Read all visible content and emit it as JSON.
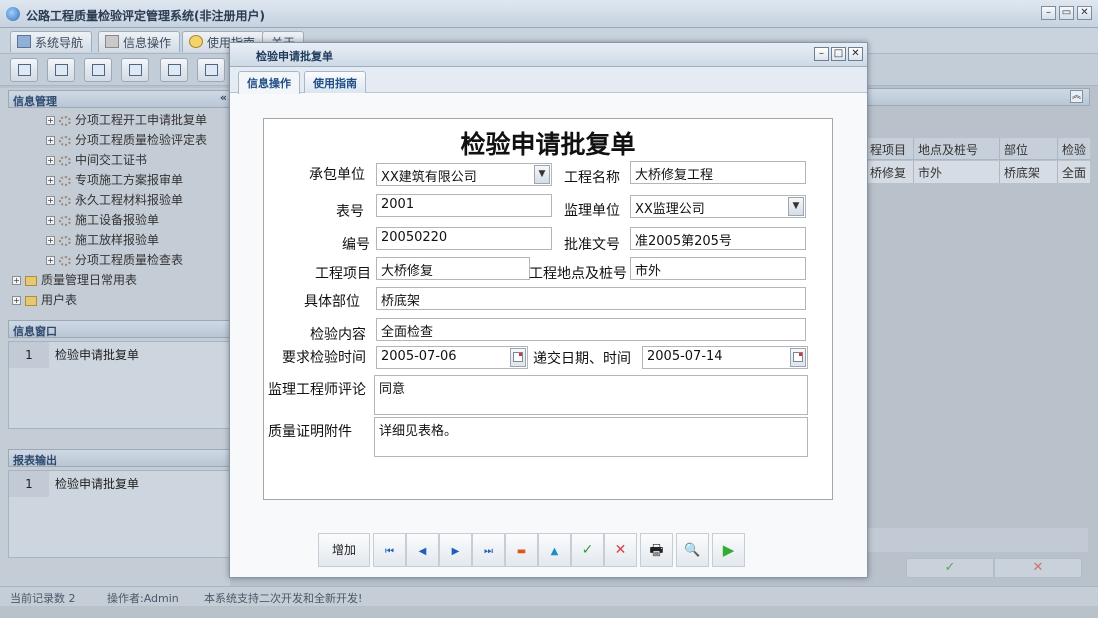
{
  "app": {
    "title": "公路工程质量检验评定管理系统(非注册用户)",
    "window_buttons": [
      "–",
      "▭",
      "✕"
    ]
  },
  "menu": {
    "tabs": [
      "系统导航",
      "信息操作",
      "使用指南",
      "关于"
    ]
  },
  "left": {
    "info_manage_title": "信息管理",
    "collapse_glyph": "«",
    "tree": [
      "分项工程开工申请批复单",
      "分项工程质量检验评定表",
      "中间交工证书",
      "专项施工方案报审单",
      "永久工程材料报验单",
      "施工设备报验单",
      "施工放样报验单",
      "分项工程质量检查表"
    ],
    "folders": [
      "质量管理日常用表",
      "用户表"
    ],
    "info_window_title": "信息窗口",
    "info_window_rows": [
      {
        "num": "1",
        "label": "检验申请批复单"
      }
    ],
    "report_title": "报表输出",
    "report_rows": [
      {
        "num": "1",
        "label": "检验申请批复单"
      }
    ]
  },
  "right": {
    "expand_glyph": "«",
    "grid_headers": [
      "程项目",
      "地点及桩号",
      "部位",
      "检验"
    ],
    "grid_row": [
      "桥修复",
      "市外",
      "桥底架",
      "全面"
    ],
    "check_glyph": "✓",
    "cross_glyph": "✕"
  },
  "status": {
    "records": "当前记录数 2",
    "operator": "操作者:Admin",
    "notice": "本系统支持二次开发和全新开发!"
  },
  "dialog": {
    "title": "检验申请批复单",
    "window_buttons": [
      "–",
      "□",
      "✕"
    ],
    "tabs": [
      "信息操作",
      "使用指南"
    ],
    "form_title": "检验申请批复单",
    "labels": {
      "contractor": "承包单位",
      "project_name": "工程名称",
      "form_no": "表号",
      "supervisor": "监理单位",
      "serial_no": "编号",
      "approval_no": "批准文号",
      "project_item": "工程项目",
      "location": "工程地点及桩号",
      "part": "具体部位",
      "content": "检验内容",
      "req_time": "要求检验时间",
      "submit_time": "递交日期、时间",
      "engineer_comment": "监理工程师评论",
      "attachment": "质量证明附件"
    },
    "values": {
      "contractor": "XX建筑有限公司",
      "project_name": "大桥修复工程",
      "form_no": "2001",
      "supervisor": "XX监理公司",
      "serial_no": "20050220",
      "approval_no": "准2005第205号",
      "project_item": "大桥修复",
      "location": "市外",
      "part": "桥底架",
      "content": "全面检查",
      "req_time": "2005-07-06",
      "submit_time": "2005-07-14",
      "engineer_comment": "同意",
      "attachment": "详细见表格。"
    },
    "combo_glyph": "▼",
    "nav": {
      "add": "增加",
      "first": "⏮",
      "prev": "◀",
      "next": "▶",
      "last": "⏭",
      "delete": "▬",
      "up": "▲",
      "confirm": "✓",
      "cancel": "✕",
      "print": "🖶",
      "preview": "🔍",
      "run": "▶"
    },
    "colors": {
      "delete": "#e0541c",
      "up": "#1b8fc4",
      "confirm": "#3c9a3c",
      "cancel": "#d64040",
      "run": "#2fae2f",
      "nav_blue": "#1c5fb8"
    }
  }
}
